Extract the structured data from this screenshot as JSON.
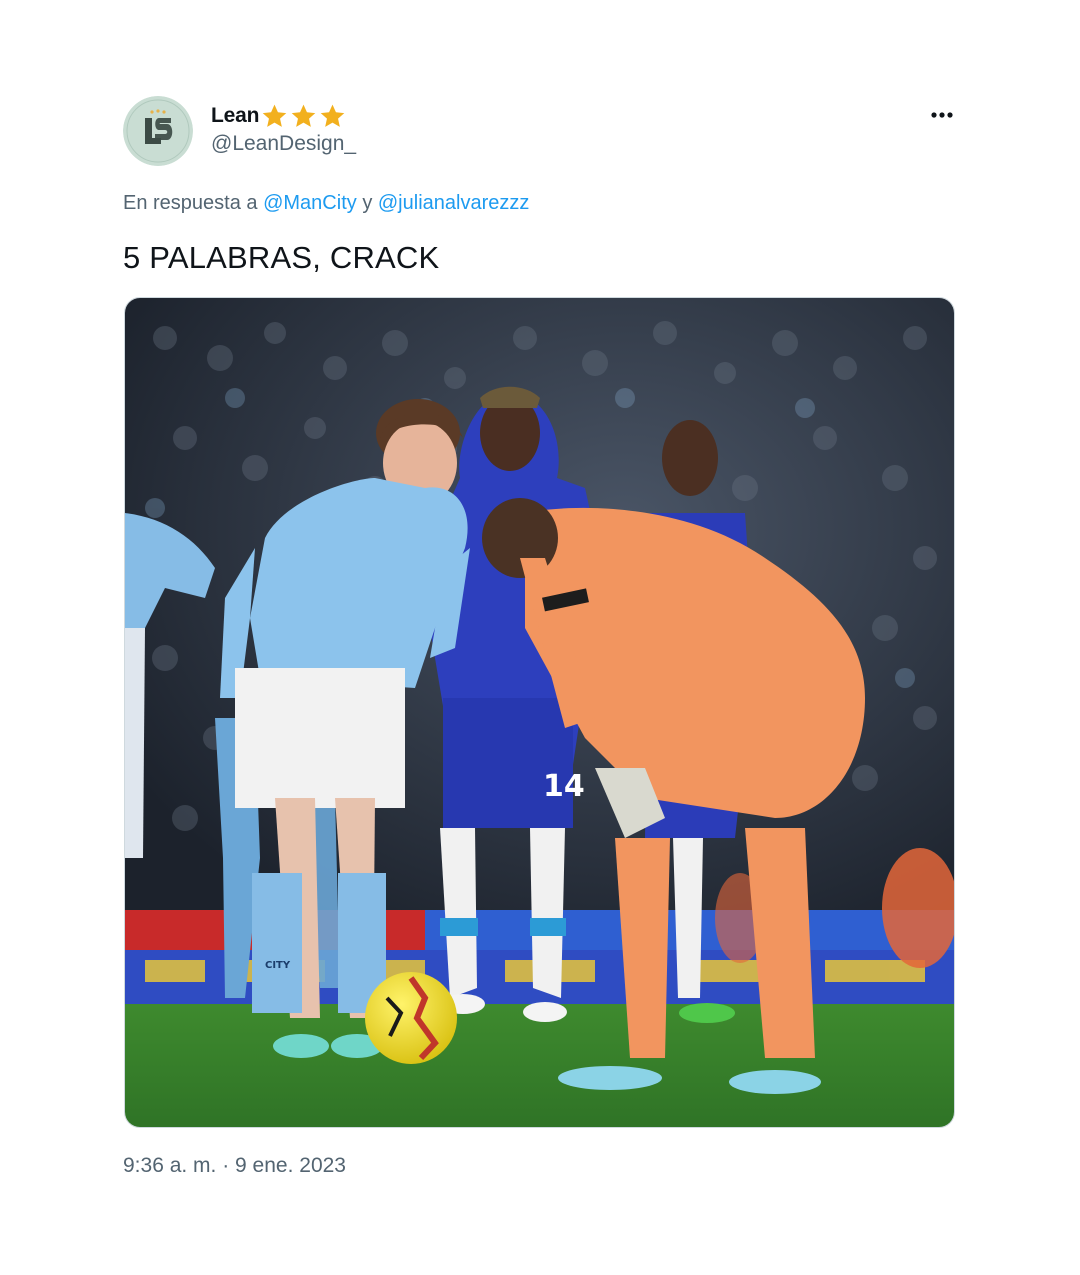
{
  "author": {
    "display_name": "Lean",
    "badge_stars": 3,
    "handle": "@LeanDesign_",
    "avatar_icon": "ls-monogram-logo",
    "colors": {
      "avatar_bg": "#c7dcd2",
      "star": "#f2b01e"
    }
  },
  "menu": {
    "more_icon": "more-horizontal-icon"
  },
  "reply": {
    "prefix": "En respuesta a",
    "mention_1": "@ManCity",
    "conjunction": "y",
    "mention_2": "@julianalvarezzz",
    "link_color": "#1d9bf0"
  },
  "tweet": {
    "text": "5 PALABRAS, CRACK",
    "timestamp": "9:36 a. m. · 9 ene. 2023"
  },
  "media": {
    "jersey_numbers": {
      "blue_kit_player": "14"
    },
    "kit_text": "CITY"
  }
}
